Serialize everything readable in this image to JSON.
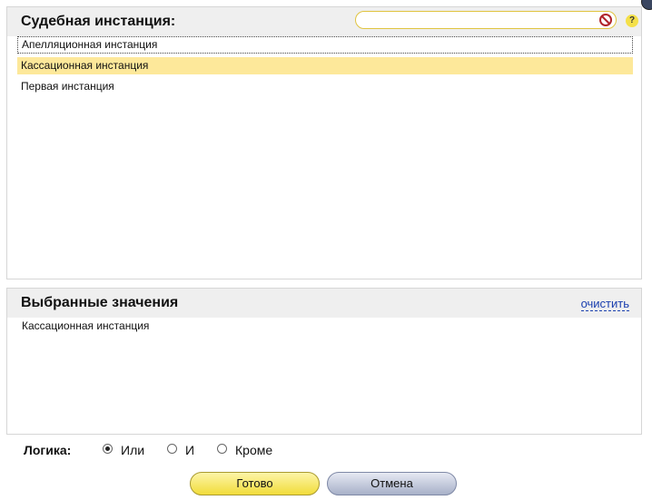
{
  "instances_panel": {
    "title": "Судебная инстанция:",
    "search": {
      "value": "",
      "placeholder": ""
    },
    "items": [
      {
        "label": "Апелляционная инстанция",
        "state": "focused"
      },
      {
        "label": "Кассационная инстанция",
        "state": "selected"
      },
      {
        "label": "Первая инстанция",
        "state": "normal"
      }
    ]
  },
  "selected_panel": {
    "title": "Выбранные значения",
    "clear_label": "очистить",
    "values": [
      "Кассационная инстанция"
    ]
  },
  "logic": {
    "label": "Логика:",
    "options": [
      {
        "label": "Или",
        "checked": true
      },
      {
        "label": "И",
        "checked": false
      },
      {
        "label": "Кроме",
        "checked": false
      }
    ]
  },
  "buttons": {
    "ok_label": "Готово",
    "cancel_label": "Отмена"
  },
  "colors": {
    "selection": "#fde89a",
    "link": "#1a3fae",
    "ok_button": "#f1dc3a",
    "cancel_button": "#a7b0c8"
  }
}
